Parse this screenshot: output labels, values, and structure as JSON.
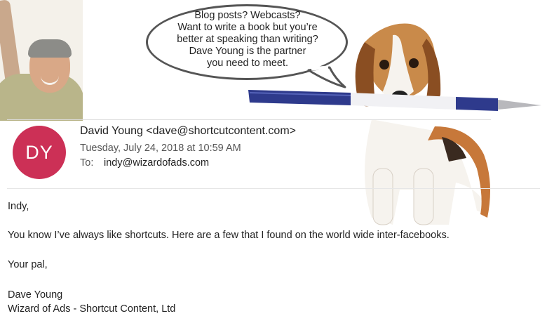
{
  "bubble": {
    "lines": [
      "Blog posts? Webcasts?",
      "Want to write a book but you’re",
      "better at speaking than writing?",
      "Dave Young is the partner",
      "you need to meet."
    ]
  },
  "email": {
    "avatar_initials": "DY",
    "avatar_color": "#cc3056",
    "from": "David Young <dave@shortcutcontent.com>",
    "date": "Tuesday, July 24, 2018 at 10:59 AM",
    "to_label": "To:",
    "to": "indy@wizardofads.com",
    "body": {
      "greeting": "Indy,",
      "message": "You know I’ve always like shortcuts. Here are a few that I found on the world wide inter-facebooks.",
      "closing": "Your pal,",
      "signature_name": "Dave Young",
      "signature_company": "Wizard of Ads - Shortcut Content, Ltd"
    }
  }
}
